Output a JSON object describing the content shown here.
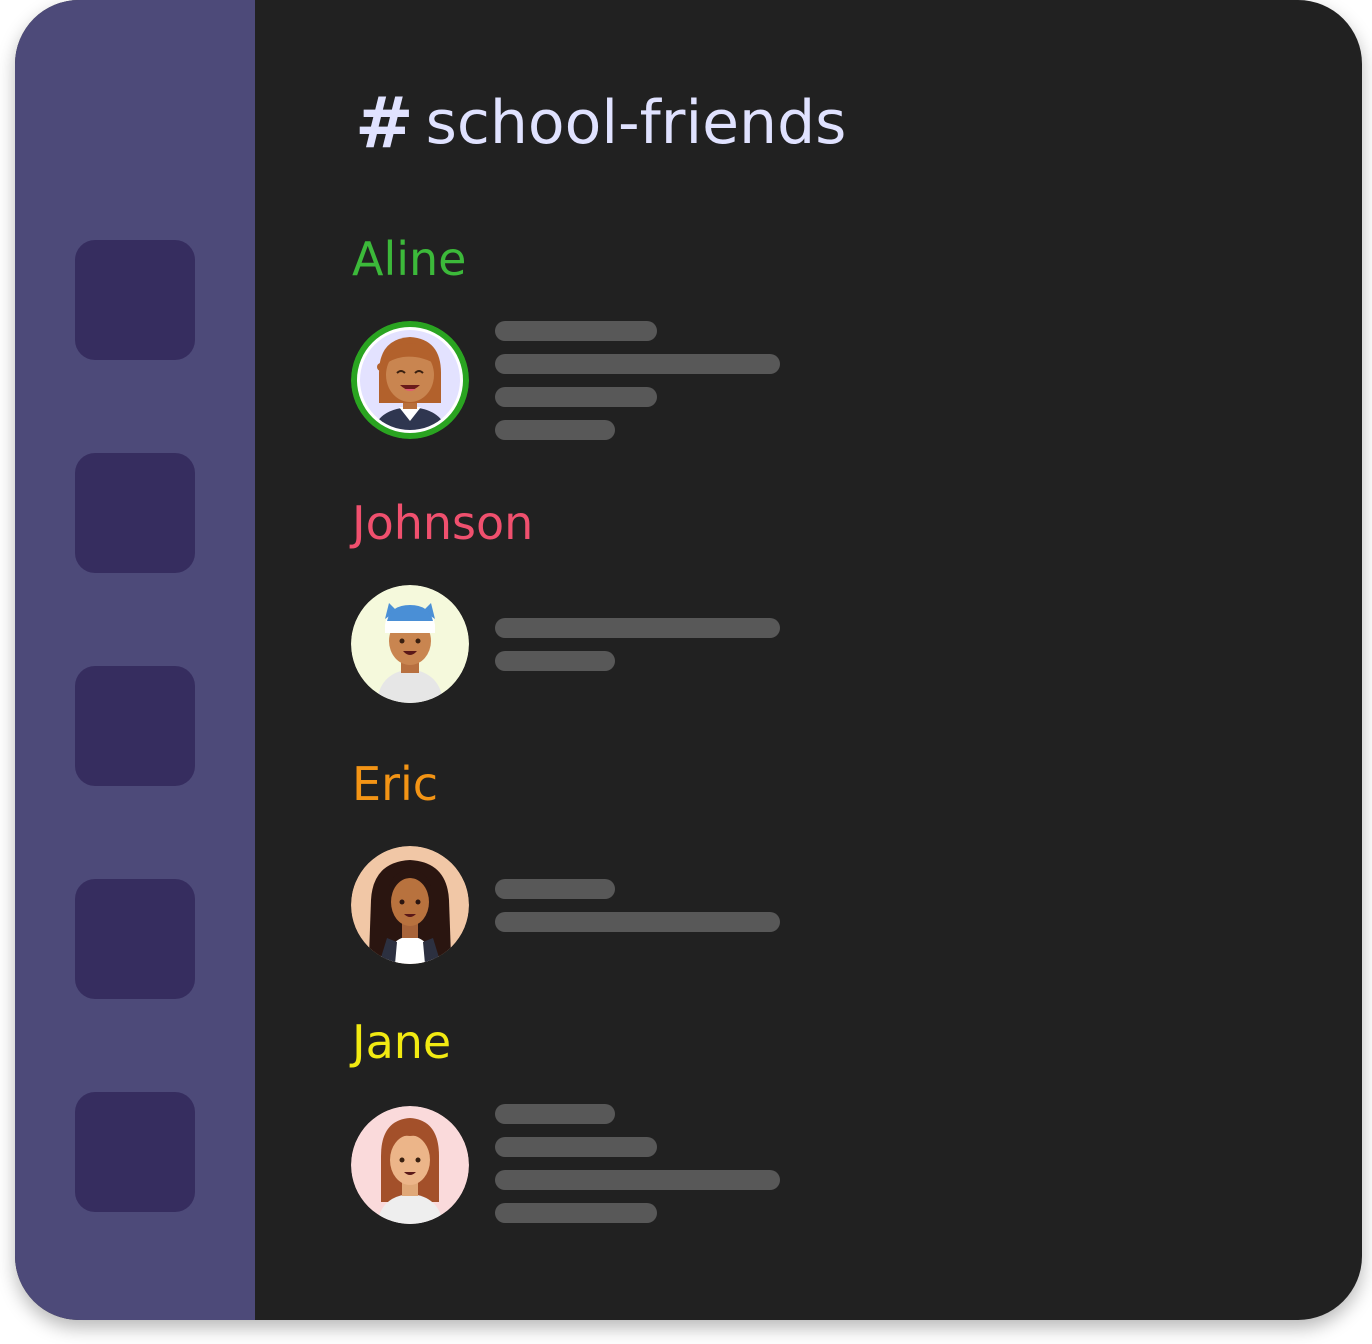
{
  "channel": {
    "hash_symbol": "#",
    "name": "school-friends"
  },
  "colors": {
    "sidebar": "#4d4a79",
    "server_icon": "#362d5f",
    "background": "#212121",
    "placeholder_line": "#585858",
    "title": "#e0e2ff"
  },
  "sidebar": {
    "servers": [
      {
        "icon": "server-icon"
      },
      {
        "icon": "server-icon"
      },
      {
        "icon": "server-icon"
      },
      {
        "icon": "server-icon"
      },
      {
        "icon": "server-icon"
      }
    ]
  },
  "messages": [
    {
      "author": "Aline",
      "color": "#3cb93a",
      "avatar": "aline-avatar-icon",
      "online": true
    },
    {
      "author": "Johnson",
      "color": "#f0506e",
      "avatar": "johnson-avatar-icon",
      "online": false
    },
    {
      "author": "Eric",
      "color": "#f39415",
      "avatar": "eric-avatar-icon",
      "online": false
    },
    {
      "author": "Jane",
      "color": "#f2ea12",
      "avatar": "jane-avatar-icon",
      "online": false
    }
  ]
}
